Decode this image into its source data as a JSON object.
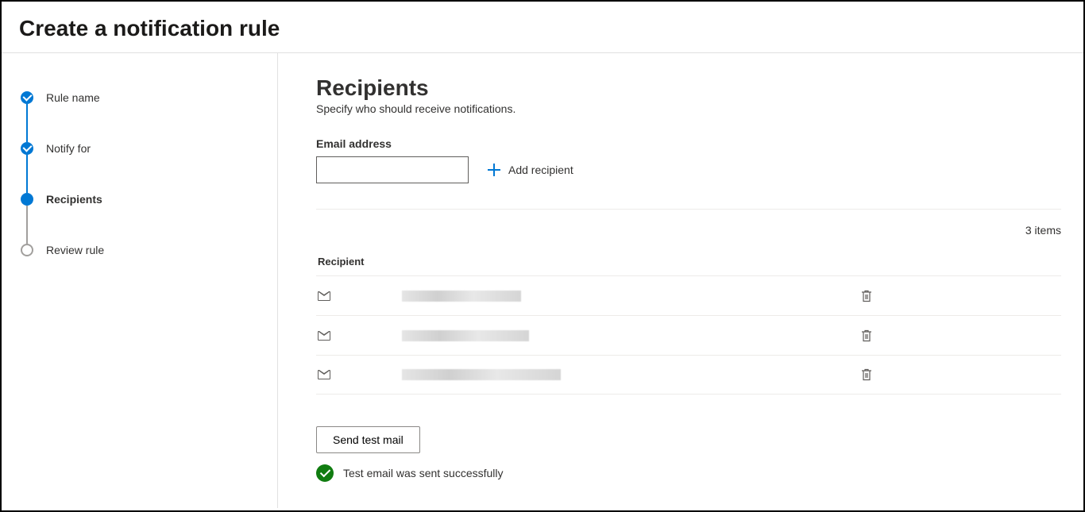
{
  "page": {
    "title": "Create a notification rule"
  },
  "steps": [
    {
      "label": "Rule name",
      "state": "completed"
    },
    {
      "label": "Notify for",
      "state": "completed"
    },
    {
      "label": "Recipients",
      "state": "current"
    },
    {
      "label": "Review rule",
      "state": "upcoming"
    }
  ],
  "main": {
    "heading": "Recipients",
    "subtitle": "Specify who should receive notifications.",
    "email_label": "Email address",
    "email_value": "",
    "add_label": "Add recipient",
    "items_count_text": "3 items",
    "column_header": "Recipient",
    "recipients": [
      {
        "email": "[redacted]"
      },
      {
        "email": "[redacted]"
      },
      {
        "email": "[redacted]"
      }
    ],
    "send_test_label": "Send test mail",
    "status_text": "Test email was sent successfully"
  }
}
